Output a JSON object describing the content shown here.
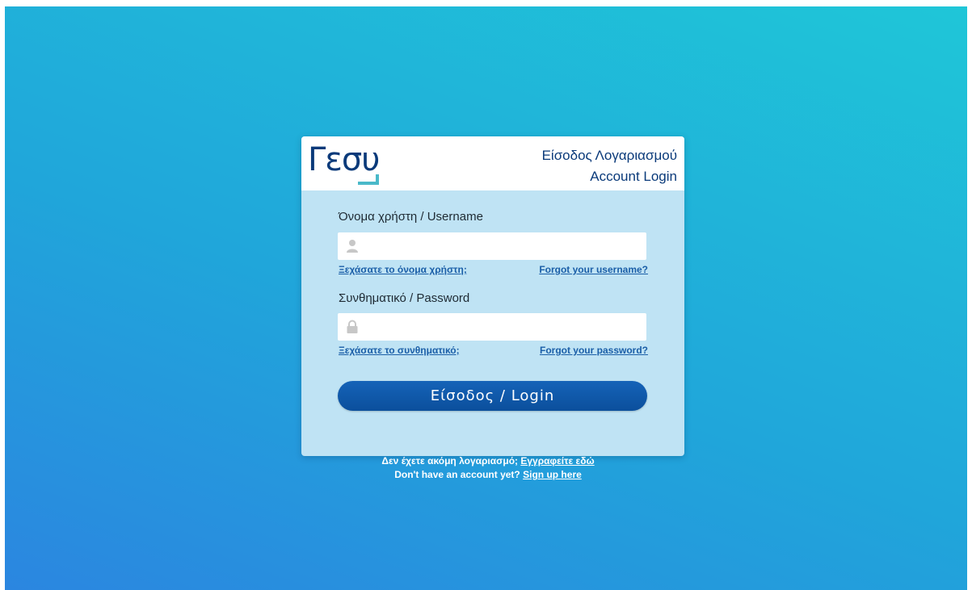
{
  "header": {
    "logo_text": "Γεσυ",
    "title_gr": "Είσοδος Λογαριασμού",
    "title_en": "Account Login"
  },
  "username": {
    "label": "Όνομα χρήστη / Username",
    "value": "",
    "icon": "user-icon",
    "forgot_gr": "Ξεχάσατε το όνομα χρήστη;",
    "forgot_en": "Forgot your username?"
  },
  "password": {
    "label": "Συνθηματικό / Password",
    "value": "",
    "icon": "lock-icon",
    "forgot_gr": "Ξεχάσατε το συνθηματικό;",
    "forgot_en": "Forgot your password?"
  },
  "login_button": "Είσοδος / Login",
  "signup": {
    "line1_text": "Δεν έχετε ακόμη λογαριασμό;",
    "line1_link": "Εγγραφείτε εδώ",
    "line2_text": "Don't have an account yet?",
    "line2_link": "Sign up here"
  },
  "colors": {
    "primary": "#0b4f9c",
    "accent": "#4ab9c9",
    "card_bg": "#bfe3f4"
  }
}
